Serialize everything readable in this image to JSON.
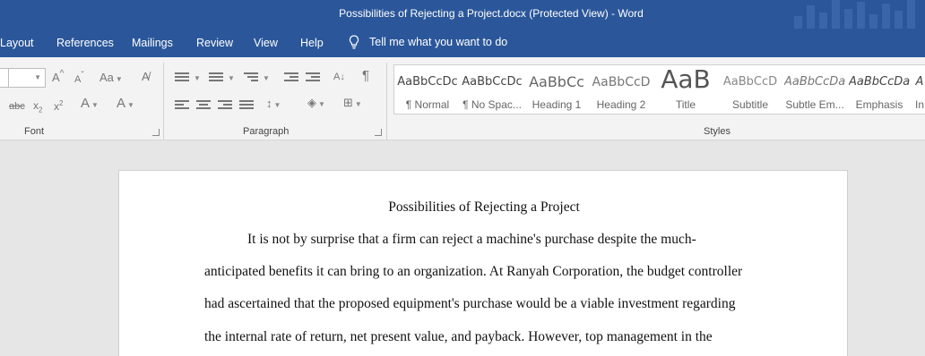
{
  "window": {
    "title": "Possibilities of Rejecting a Project.docx (Protected View)  -  Word"
  },
  "tabs": [
    "Layout",
    "References",
    "Mailings",
    "Review",
    "View",
    "Help"
  ],
  "tell_me": "Tell me what you want to do",
  "ribbon": {
    "font_group": "Font",
    "paragraph_group": "Paragraph",
    "styles_group": "Styles",
    "styles": [
      {
        "sample": "AaBbCcDc",
        "name": "¶ Normal"
      },
      {
        "sample": "AaBbCcDc",
        "name": "¶ No Spac..."
      },
      {
        "sample": "AaBbCc",
        "name": "Heading 1"
      },
      {
        "sample": "AaBbCcD",
        "name": "Heading 2"
      },
      {
        "sample": "AaB",
        "name": "Title"
      },
      {
        "sample": "AaBbCcD",
        "name": "Subtitle"
      },
      {
        "sample": "AaBbCcDa",
        "name": "Subtle Em..."
      },
      {
        "sample": "AaBbCcDa",
        "name": "Emphasis"
      },
      {
        "sample": "A",
        "name": "In"
      }
    ]
  },
  "document": {
    "title": "Possibilities of Rejecting a Project",
    "lines": [
      "It is not by surprise that a firm can reject a machine's purchase despite the much-",
      "anticipated benefits it can bring to an organization. At Ranyah Corporation, the budget controller",
      "had ascertained that the proposed equipment's purchase would be a viable investment regarding",
      "the internal rate of return, net present value, and payback. However, top management in the"
    ]
  },
  "colors": {
    "brand": "#2b579a",
    "ribbon_bg": "#f3f3f3",
    "canvas_bg": "#e6e6e6"
  }
}
